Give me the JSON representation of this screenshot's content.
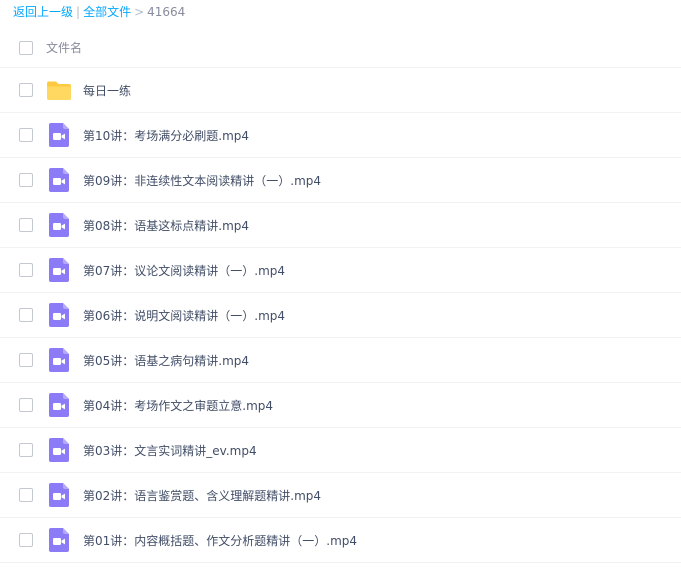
{
  "breadcrumb": {
    "back": "返回上一级",
    "separator1": "|",
    "all_files": "全部文件",
    "separator2": ">",
    "current": "41664"
  },
  "header": {
    "column_name": "文件名"
  },
  "files": [
    {
      "name": "每日一练",
      "type": "folder",
      "icon": "folder-icon"
    },
    {
      "name": "第10讲：考场满分必刷题.mp4",
      "type": "video",
      "icon": "video-file-icon"
    },
    {
      "name": "第09讲：非连续性文本阅读精讲（一）.mp4",
      "type": "video",
      "icon": "video-file-icon"
    },
    {
      "name": "第08讲：语基这标点精讲.mp4",
      "type": "video",
      "icon": "video-file-icon"
    },
    {
      "name": "第07讲：议论文阅读精讲（一）.mp4",
      "type": "video",
      "icon": "video-file-icon"
    },
    {
      "name": "第06讲：说明文阅读精讲（一）.mp4",
      "type": "video",
      "icon": "video-file-icon"
    },
    {
      "name": "第05讲：语基之病句精讲.mp4",
      "type": "video",
      "icon": "video-file-icon"
    },
    {
      "name": "第04讲：考场作文之审题立意.mp4",
      "type": "video",
      "icon": "video-file-icon"
    },
    {
      "name": "第03讲：文言实词精讲_ev.mp4",
      "type": "video",
      "icon": "video-file-icon"
    },
    {
      "name": "第02讲：语言鉴赏题、含义理解题精讲.mp4",
      "type": "video",
      "icon": "video-file-icon"
    },
    {
      "name": "第01讲：内容概括题、作文分析题精讲（一）.mp4",
      "type": "video",
      "icon": "video-file-icon"
    }
  ],
  "colors": {
    "link": "#06a7ff",
    "folder": "#ffd05a",
    "video": "#8c7bf6",
    "text": "#424e67"
  }
}
